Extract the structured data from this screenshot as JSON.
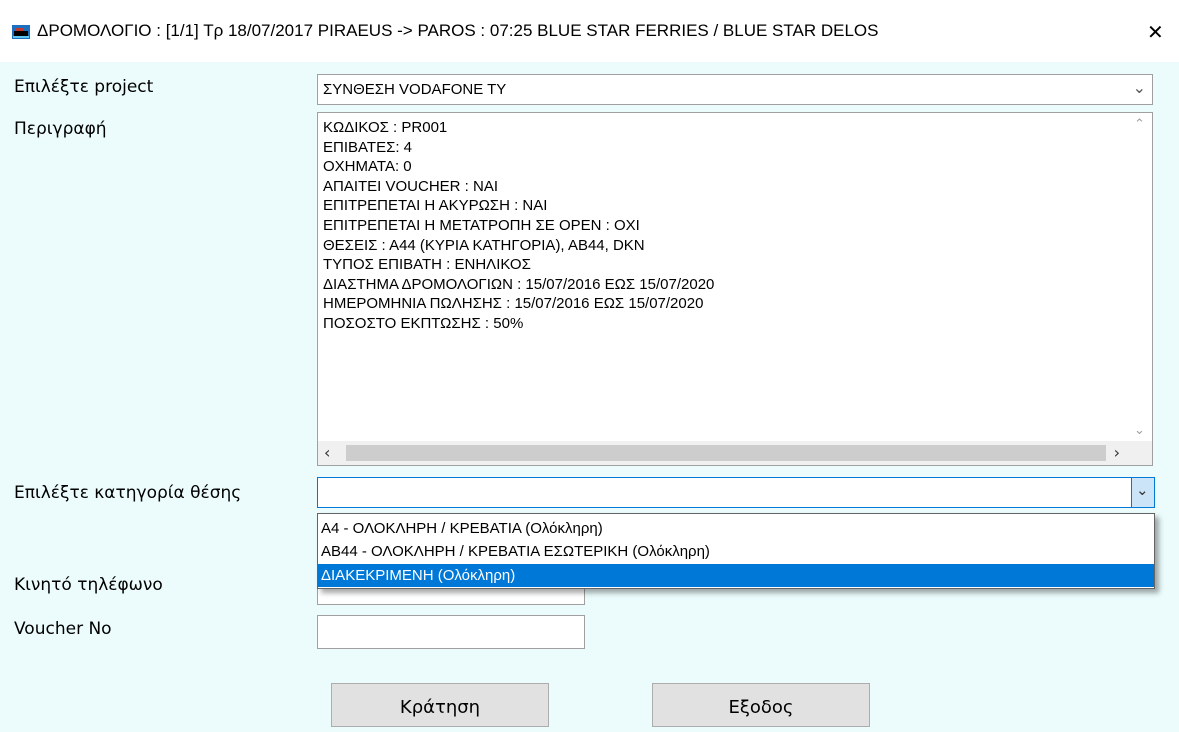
{
  "window": {
    "title": "ΔΡΟΜΟΛΟΓΙΟ : [1/1]  Τρ 18/07/2017   PIRAEUS -> PAROS : 07:25   BLUE STAR FERRIES  /  BLUE STAR DELOS",
    "close_glyph": "✕",
    "icon": "ferry-app-icon"
  },
  "form": {
    "project_label": "Επιλέξτε project",
    "project_value": "ΣΥΝΘΕΣΗ VODAFONE TY",
    "description_label": "Περιγραφή",
    "description_lines": [
      "ΚΩΔΙΚΟΣ : PR001",
      "ΕΠΙΒΑΤΕΣ: 4",
      "ΟΧΗΜΑΤΑ: 0",
      "ΑΠΑΙΤΕΙ VOUCHER : ΝΑΙ",
      "ΕΠΙΤΡΕΠΕΤΑΙ Η ΑΚΥΡΩΣΗ : ΝΑΙ",
      "ΕΠΙΤΡΕΠΕΤΑΙ Η ΜΕΤΑΤΡΟΠΗ ΣΕ OPEN : ΟΧΙ",
      "ΘΕΣΕΙΣ : Α44 (ΚΥΡΙΑ ΚΑΤΗΓΟΡΙΑ), ΑΒ44, DKN",
      "ΤΥΠΟΣ ΕΠΙΒΑΤΗ : ΕΝΗΛΙΚΟΣ",
      "ΔΙΑΣΤΗΜΑ ΔΡΟΜΟΛΟΓΙΩΝ : 15/07/2016 ΕΩΣ 15/07/2020",
      "ΗΜΕΡΟΜΗΝΙΑ ΠΩΛΗΣΗΣ : 15/07/2016 ΕΩΣ 15/07/2020",
      "ΠΟΣΟΣΤΟ ΕΚΠΤΩΣΗΣ : 50%"
    ],
    "category_label": "Επιλέξτε κατηγορία θέσης",
    "category_value": "",
    "category_options": [
      "Α4 - ΟΛΟΚΛΗΡΗ / ΚΡΕΒΑΤΙΑ (Ολόκληρη)",
      "ΑΒ44 - ΟΛΟΚΛΗΡΗ / ΚΡΕΒΑΤΙΑ ΕΣΩΤΕΡΙΚΗ (Ολόκληρη)",
      "ΔΙΑΚΕΚΡΙΜΕΝΗ (Ολόκληρη)"
    ],
    "category_highlighted_index": 2,
    "mobile_label": "Κινητό τηλέφωνο",
    "mobile_value": "",
    "voucher_label": "Voucher No",
    "voucher_value": ""
  },
  "buttons": {
    "book": "Κράτηση",
    "exit": "Εξοδος"
  },
  "colors": {
    "background": "#ecfcfc",
    "selection": "#0078d7"
  }
}
